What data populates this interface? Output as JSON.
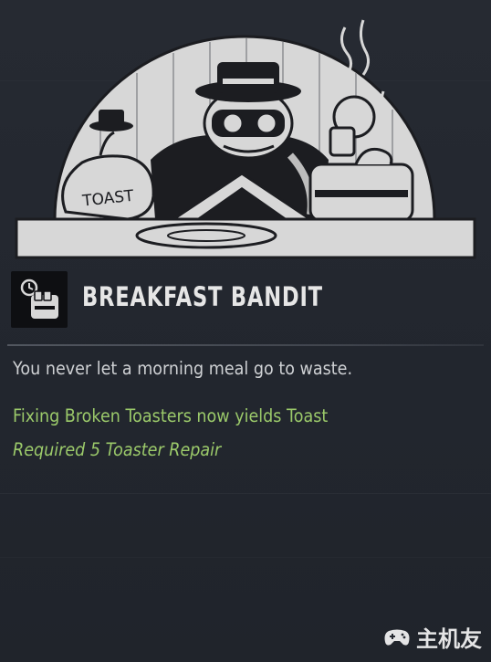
{
  "perk": {
    "title": "BREAKFAST BANDIT",
    "description": "You never let a morning meal go to waste.",
    "effect": "Fixing Broken Toasters now yields Toast",
    "requirement": "Required 5 Toaster Repair",
    "illustration": {
      "bag_label": "TOAST"
    },
    "icon": "toaster-icon"
  },
  "watermark": {
    "text": "主机友",
    "icon": "gamepad-icon"
  },
  "colors": {
    "background": "#23272f",
    "title": "#e6e6e6",
    "description": "#cfd1d4",
    "effect": "#9bc96a",
    "illustration_light": "#d9d9d9",
    "illustration_dark": "#1c1d21"
  }
}
